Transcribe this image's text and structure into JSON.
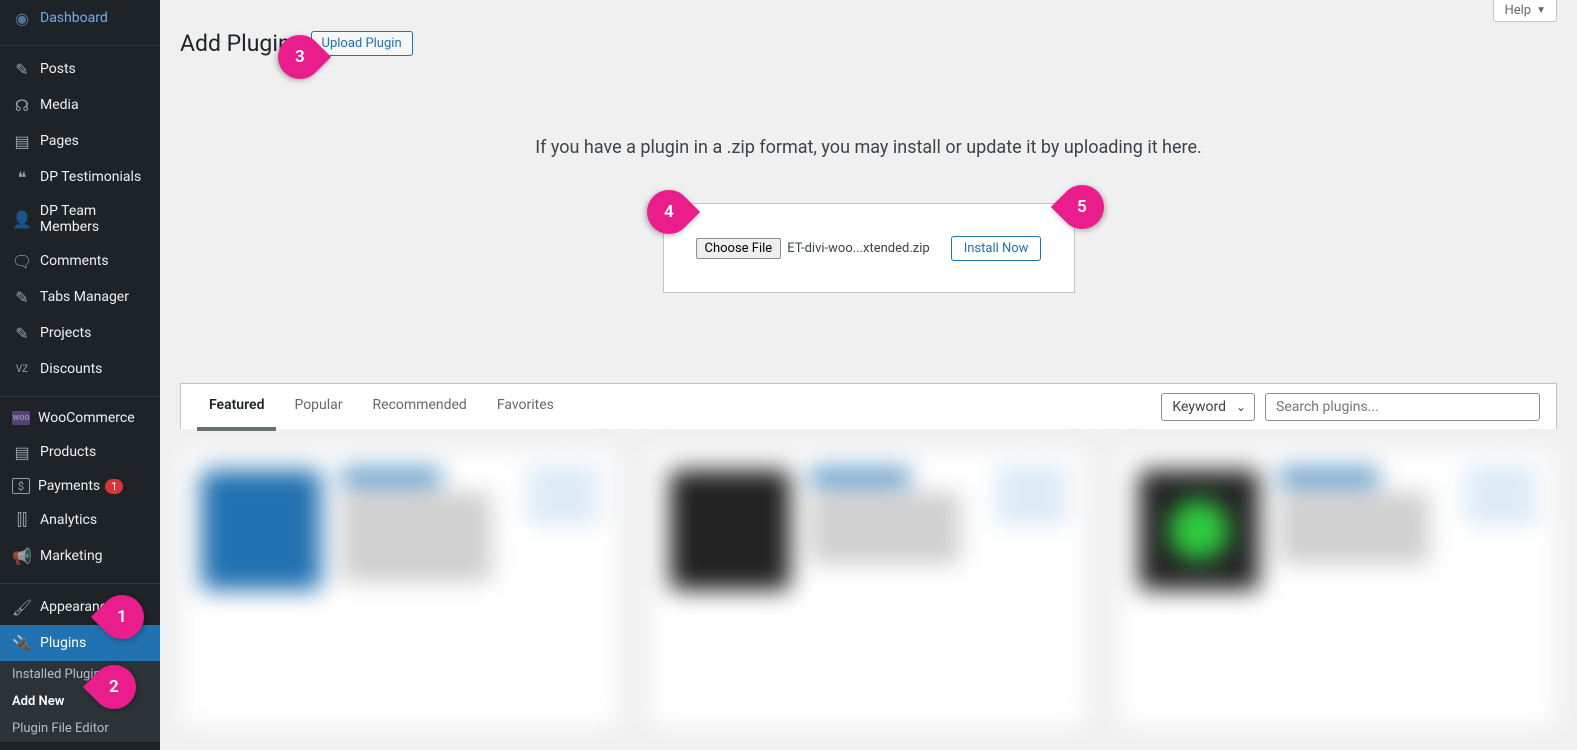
{
  "sidebar": {
    "items": [
      {
        "label": "Dashboard",
        "icon": "⌂"
      },
      {
        "label": "Posts",
        "icon": "📌"
      },
      {
        "label": "Media",
        "icon": "🖼"
      },
      {
        "label": "Pages",
        "icon": "▤"
      },
      {
        "label": "DP Testimonials",
        "icon": "❝"
      },
      {
        "label": "DP Team Members",
        "icon": "👤"
      },
      {
        "label": "Comments",
        "icon": "💬"
      },
      {
        "label": "Tabs Manager",
        "icon": "📌"
      },
      {
        "label": "Projects",
        "icon": "📌"
      },
      {
        "label": "Discounts",
        "icon": "vz"
      },
      {
        "label": "WooCommerce",
        "icon": "W"
      },
      {
        "label": "Products",
        "icon": "▤"
      },
      {
        "label": "Payments",
        "icon": "$",
        "badge": "1"
      },
      {
        "label": "Analytics",
        "icon": "📊"
      },
      {
        "label": "Marketing",
        "icon": "📣"
      },
      {
        "label": "Appearance",
        "icon": "🖌"
      },
      {
        "label": "Plugins",
        "icon": "🔌",
        "active": true
      }
    ],
    "submenu": [
      {
        "label": "Installed Plugins"
      },
      {
        "label": "Add New",
        "active": true
      },
      {
        "label": "Plugin File Editor"
      }
    ]
  },
  "header": {
    "title": "Add Plugins",
    "upload_btn": "Upload Plugin",
    "help_label": "Help"
  },
  "upload_panel": {
    "text": "If you have a plugin in a .zip format, you may install or update it by uploading it here.",
    "choose_file": "Choose File",
    "filename": "ET-divi-woo...xtended.zip",
    "install_btn": "Install Now"
  },
  "tabs": [
    {
      "label": "Featured",
      "active": true
    },
    {
      "label": "Popular"
    },
    {
      "label": "Recommended"
    },
    {
      "label": "Favorites"
    }
  ],
  "filter": {
    "keyword": "Keyword",
    "search_placeholder": "Search plugins..."
  },
  "markers": {
    "s1": "1",
    "s2": "2",
    "s3": "3",
    "s4": "4",
    "s5": "5"
  }
}
